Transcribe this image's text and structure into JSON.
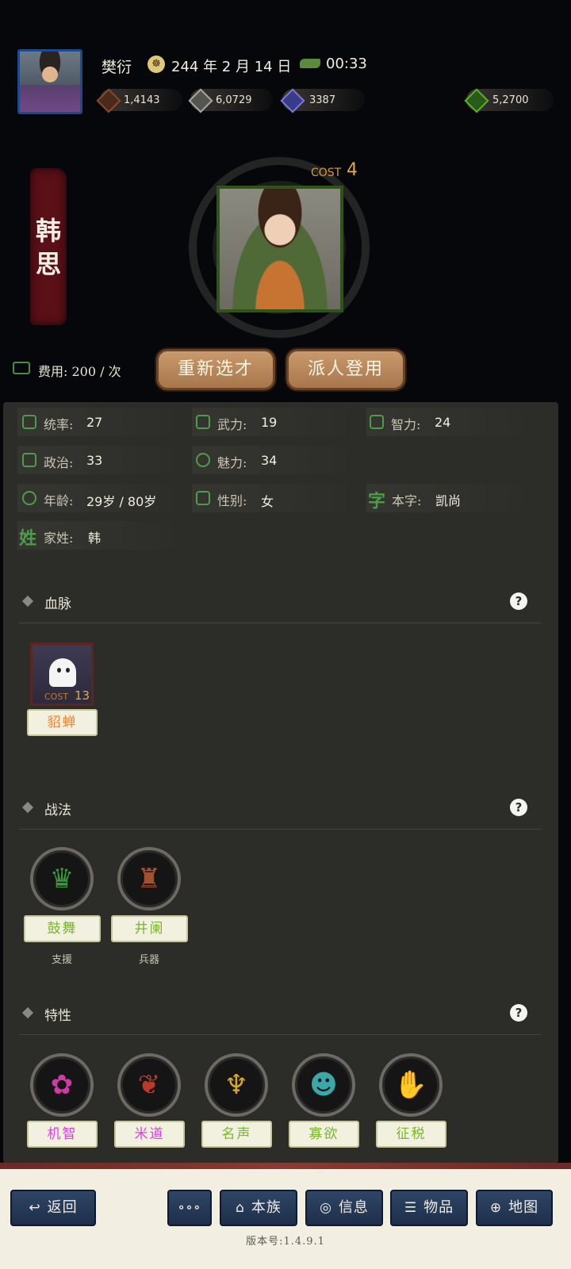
{
  "header": {
    "player_name": "樊衍",
    "date": "244 年 2 月 14 日",
    "time": "00:33",
    "resources": [
      {
        "icon": "coin-icon",
        "value": "1,4143",
        "color": "#8a4a2a"
      },
      {
        "icon": "grain-icon",
        "value": "6,0729",
        "color": "#a8a8a0"
      },
      {
        "icon": "troops-icon",
        "value": "3387",
        "color": "#5a5ab0"
      },
      {
        "icon": "money-bag-icon",
        "value": "5,2700",
        "color": "#3f8a2a"
      }
    ]
  },
  "hero": {
    "name_chars": [
      "韩",
      "思"
    ],
    "cost_label": "COST",
    "cost_value": "4",
    "fee_text": "费用: 200 / 次",
    "reselect_button": "重新选才",
    "recruit_button": "派人登用"
  },
  "stats": [
    {
      "icon": "flag-icon",
      "label": "统率:",
      "value": "27"
    },
    {
      "icon": "arm-icon",
      "label": "武力:",
      "value": "19"
    },
    {
      "icon": "brain-icon",
      "label": "智力:",
      "value": "24"
    },
    {
      "icon": "govern-icon",
      "label": "政治:",
      "value": "33"
    },
    {
      "icon": "eye-icon",
      "label": "魅力:",
      "value": "34"
    },
    {
      "icon": "age-icon",
      "label": "年龄:",
      "value": "29岁 / 80岁"
    },
    {
      "icon": "gender-icon",
      "label": "性别:",
      "value": "女"
    },
    {
      "icon": "zi-icon",
      "glyph": "字",
      "label": "本字:",
      "value": "凯尚"
    },
    {
      "icon": "xing-icon",
      "glyph": "姓",
      "label": "家姓:",
      "value": "韩"
    }
  ],
  "sections": {
    "bloodline": {
      "title": "血脉",
      "card": {
        "cost_label": "COST",
        "cost_value": "13",
        "name": "貂蝉"
      }
    },
    "tactics": {
      "title": "战法",
      "items": [
        {
          "icon": "drum-dance-icon",
          "name": "鼓舞",
          "sub": "支援"
        },
        {
          "icon": "tower-icon",
          "name": "井阑",
          "sub": "兵器"
        }
      ]
    },
    "traits": {
      "title": "特性",
      "items": [
        {
          "icon": "wit-icon",
          "name": "机智",
          "color": "#e040e0"
        },
        {
          "icon": "rice-icon",
          "name": "米道",
          "color": "#e040e0"
        },
        {
          "icon": "fame-icon",
          "name": "名声",
          "color": "#7ab52e"
        },
        {
          "icon": "meditate-icon",
          "name": "寡欲",
          "color": "#7ab52e"
        },
        {
          "icon": "tax-icon",
          "name": "征税",
          "color": "#7ab52e"
        }
      ]
    }
  },
  "nav": {
    "back": "返回",
    "more": "∘∘∘",
    "clan": "本族",
    "info": "信息",
    "items": "物品",
    "map": "地图"
  },
  "version": "版本号:1.4.9.1"
}
